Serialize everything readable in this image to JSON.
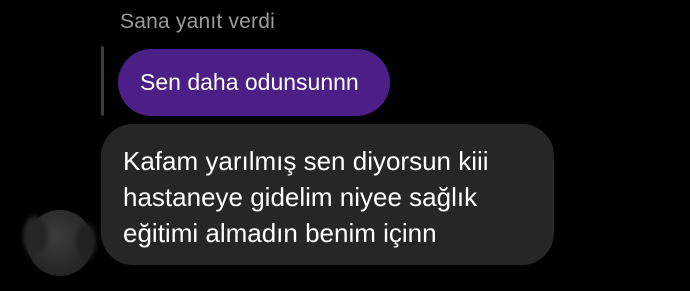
{
  "reply": {
    "header": "Sana yanıt verdi",
    "quoted_message": "Sen daha odunsunnn"
  },
  "message": {
    "lines": [
      "Kafam yarılmış sen diyorsun kiii",
      "hastaneye gidelim niyee sağlık",
      "eğitimi almadın benim içinn"
    ]
  },
  "colors": {
    "background": "#000000",
    "quoted_bubble": "#4b1f86",
    "message_bubble": "#262626",
    "header_text": "#9a9a9a"
  },
  "icons": {
    "avatar": "blurred-profile-avatar"
  }
}
